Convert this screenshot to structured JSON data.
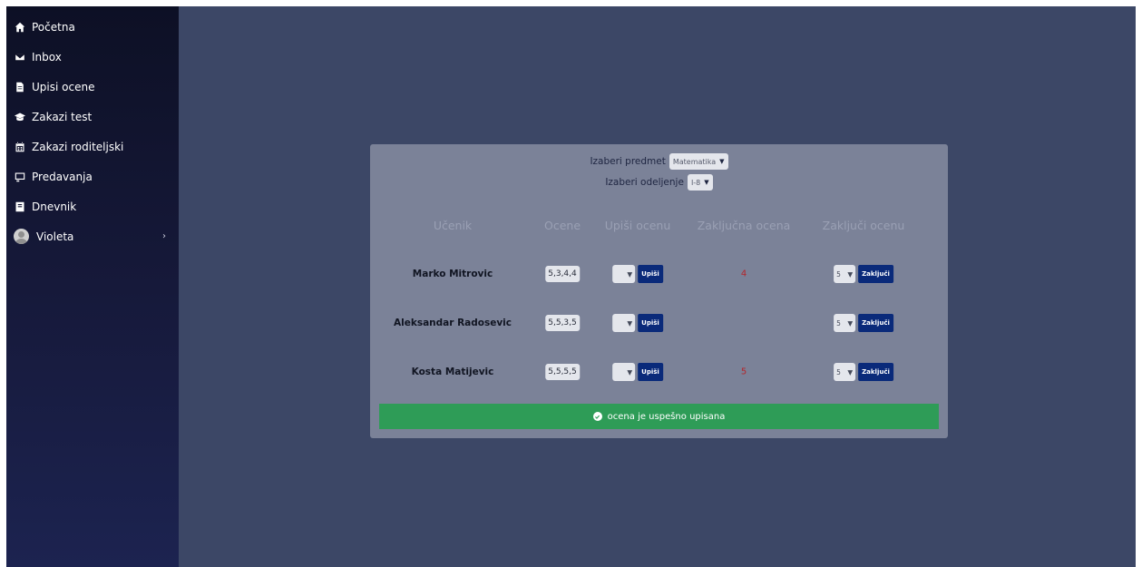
{
  "sidebar": {
    "items": [
      {
        "label": "Početna",
        "icon": "home-icon"
      },
      {
        "label": "Inbox",
        "icon": "envelope-icon"
      },
      {
        "label": "Upisi ocene",
        "icon": "file-icon"
      },
      {
        "label": "Zakazi test",
        "icon": "graduation-cap-icon"
      },
      {
        "label": "Zakazi roditeljski",
        "icon": "calendar-icon"
      },
      {
        "label": "Predavanja",
        "icon": "chalkboard-icon"
      },
      {
        "label": "Dnevnik",
        "icon": "book-icon"
      }
    ],
    "user": {
      "name": "Violeta",
      "chevron": "›"
    }
  },
  "selectors": {
    "subject_label": "Izaberi predmet",
    "subject_value": "Matematika",
    "class_label": "Izaberi odeljenje",
    "class_value": "I-8"
  },
  "table": {
    "headers": [
      "Učenik",
      "Ocene",
      "Upiši ocenu",
      "Zaključna ocena",
      "Zaključi ocenu"
    ],
    "rows": [
      {
        "student": "Marko Mitrovic",
        "grades": "5,3,4,4",
        "upis_button": "Upiši",
        "final_grade": "4",
        "zakljuci_value": "5",
        "zakljuci_button": "Zaključi"
      },
      {
        "student": "Aleksandar Radosevic",
        "grades": "5,5,3,5",
        "upis_button": "Upiši",
        "final_grade": "",
        "zakljuci_value": "5",
        "zakljuci_button": "Zaključi"
      },
      {
        "student": "Kosta Matijevic",
        "grades": "5,5,5,5",
        "upis_button": "Upiši",
        "final_grade": "5",
        "zakljuci_value": "5",
        "zakljuci_button": "Zaključi"
      }
    ]
  },
  "alert": {
    "text": "ocena je uspešno upisana",
    "color": "#2e9c57"
  },
  "colors": {
    "sidebar_bg": "#0d1025",
    "main_bg": "#3c4766",
    "panel_bg": "#7b8298",
    "button_bg": "#0a2a7a",
    "final_grade": "#b3262b"
  }
}
